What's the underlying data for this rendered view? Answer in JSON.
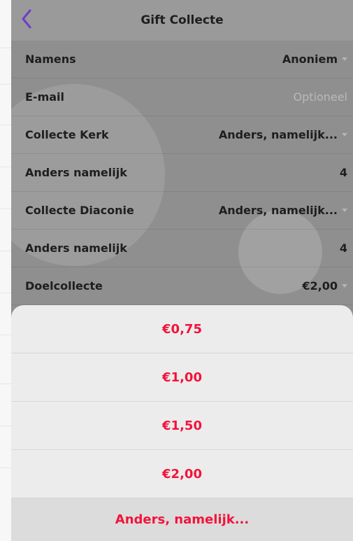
{
  "header": {
    "title": "Gift Collecte",
    "back_icon": "chevron-left-icon"
  },
  "colors": {
    "accent": "#f2133b",
    "back": "#6f3cc9",
    "overlay": "#8f8f8f"
  },
  "form": {
    "rows": [
      {
        "label": "Namens",
        "value": "Anoniem"
      },
      {
        "label": "E-mail",
        "value": "Optioneel"
      },
      {
        "label": "Collecte Kerk",
        "value": "Anders, namelijk..."
      },
      {
        "label": "Anders namelijk",
        "value": "4"
      },
      {
        "label": "Collecte Diaconie",
        "value": "Anders, namelijk..."
      },
      {
        "label": "Anders namelijk",
        "value": "4"
      },
      {
        "label": "Doelcollecte",
        "value": "€2,00"
      }
    ]
  },
  "sheet": {
    "options": [
      "€0,75",
      "€1,00",
      "€1,50",
      "€2,00",
      "Anders, namelijk..."
    ]
  }
}
